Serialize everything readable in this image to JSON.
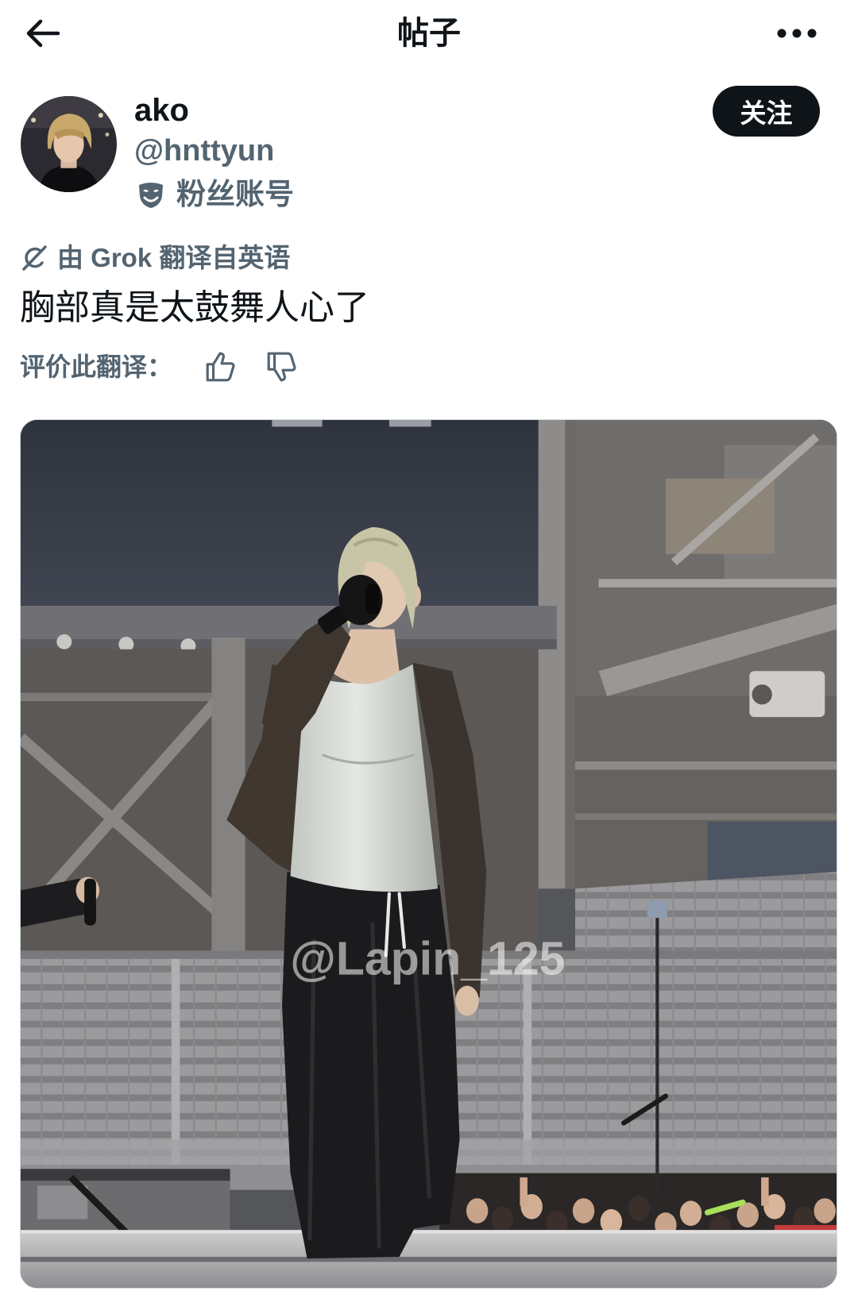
{
  "header": {
    "title": "帖子",
    "back_icon": "arrow-left-icon",
    "more_icon": "more-horizontal-icon"
  },
  "author": {
    "avatar": "avatar",
    "display_name": "ako",
    "handle": "@hnttyun",
    "badge_icon": "theater-mask-icon",
    "badge_label": "粉丝账号"
  },
  "follow_button": {
    "label": "关注"
  },
  "translation": {
    "icon": "grok-icon",
    "notice": "由 Grok 翻译自英语",
    "rate_label": "评价此翻译：",
    "thumbs_up_icon": "thumbs-up-icon",
    "thumbs_down_icon": "thumbs-down-icon"
  },
  "post": {
    "text": "胸部真是太鼓舞人心了"
  },
  "media": {
    "type": "photo",
    "watermark": "@Lapin_125"
  },
  "colors": {
    "background": "#ffffff",
    "text_primary": "#0f1419",
    "text_secondary": "#536471",
    "button_bg": "#0f1419",
    "button_text": "#ffffff",
    "media_border": "#cfd9de"
  }
}
